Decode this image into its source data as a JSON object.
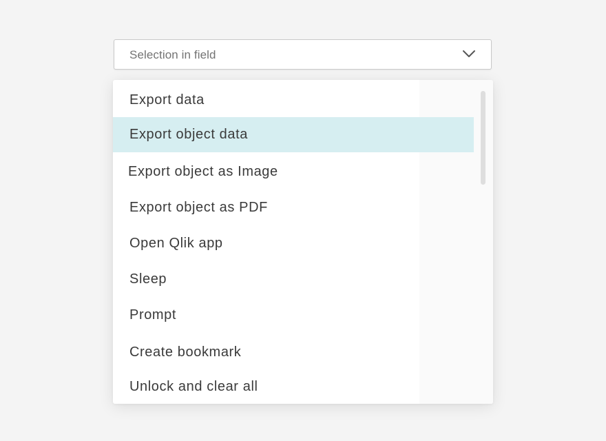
{
  "select": {
    "value": "Selection in field",
    "icon": "chevron-down-icon"
  },
  "menu": {
    "highlighted_item": "Export object data",
    "items": [
      {
        "label": "Export data"
      },
      {
        "label": "Export object data"
      },
      {
        "label": "Export object as Image"
      },
      {
        "label": "Export object as PDF"
      },
      {
        "label": "Open Qlik app"
      },
      {
        "label": "Sleep"
      },
      {
        "label": "Prompt"
      },
      {
        "label": "Create bookmark"
      },
      {
        "label": "Unlock and clear all"
      }
    ]
  },
  "colors": {
    "highlight": "#d6eef1",
    "text": "#3a3a3a",
    "placeholder": "#737373",
    "background": "#f4f4f4"
  }
}
